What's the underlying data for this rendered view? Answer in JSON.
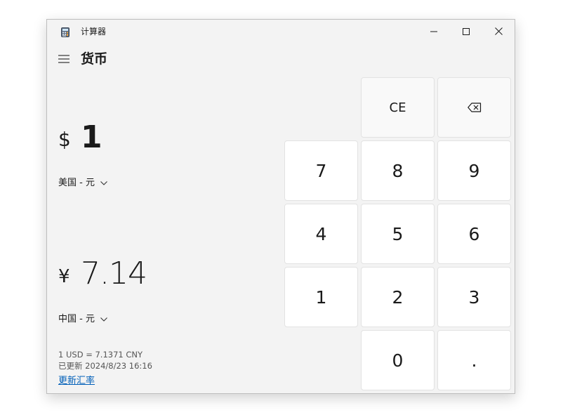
{
  "window": {
    "title": "计算器"
  },
  "header": {
    "mode_title": "货币"
  },
  "converter": {
    "from": {
      "symbol": "$",
      "value": "1",
      "currency": "美国 - 元"
    },
    "to": {
      "symbol": "¥",
      "value": "7.14",
      "currency": "中国 - 元"
    },
    "rate_text": "1 USD = 7.1371 CNY",
    "updated_text": "已更新 2024/8/23 16:16",
    "update_link": "更新汇率"
  },
  "keypad": {
    "ce": "CE",
    "backspace_icon": "backspace-icon",
    "digits": {
      "d7": "7",
      "d8": "8",
      "d9": "9",
      "d4": "4",
      "d5": "5",
      "d6": "6",
      "d1": "1",
      "d2": "2",
      "d3": "3",
      "d0": "0",
      "decimal": "."
    }
  },
  "colors": {
    "window_bg": "#f3f3f3",
    "key_bg": "#ffffff",
    "link": "#005fb8"
  }
}
